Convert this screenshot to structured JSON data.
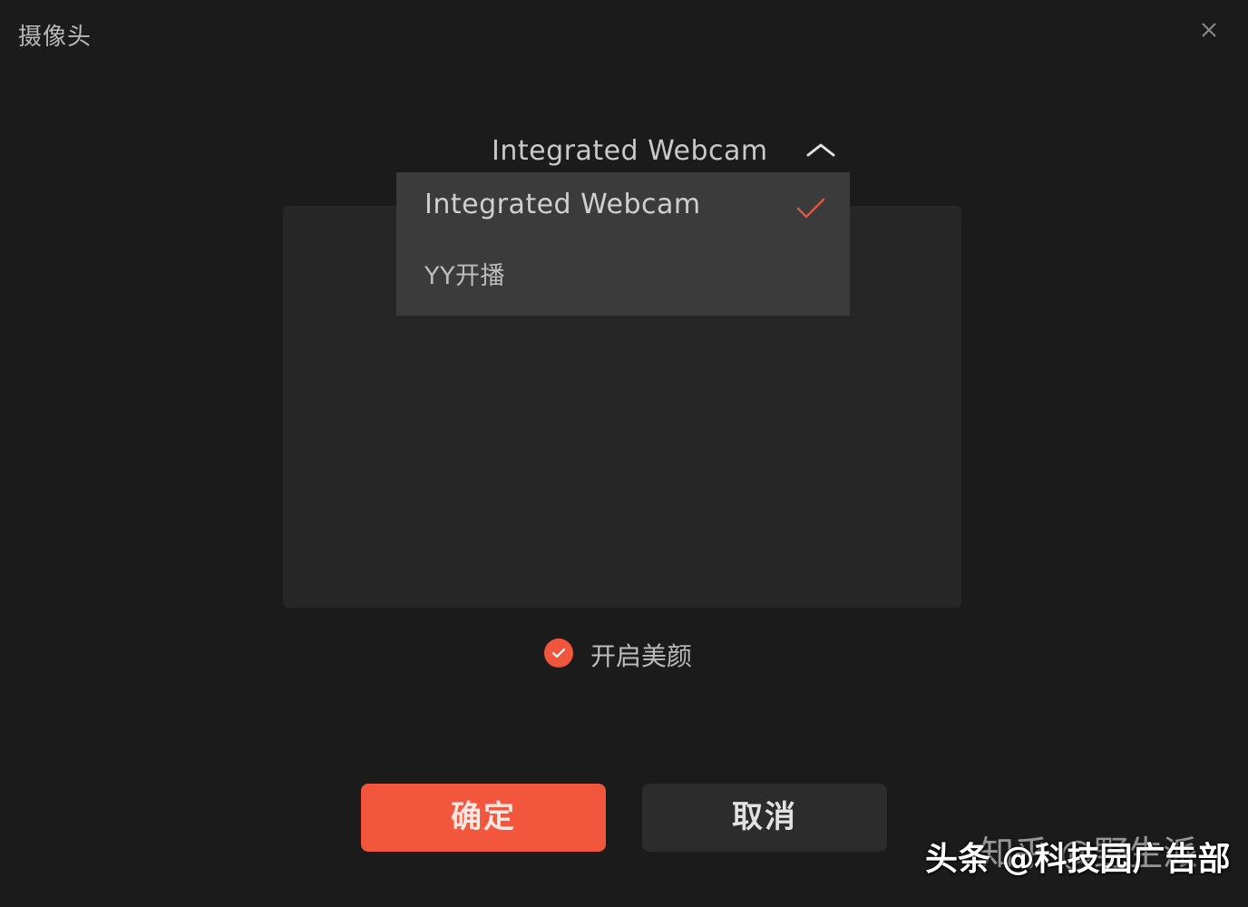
{
  "window": {
    "title": "摄像头",
    "close_icon": "close-icon"
  },
  "camera_select": {
    "selected_value": "Integrated Webcam",
    "expanded": true,
    "chevron_icon": "chevron-up-icon",
    "options": [
      {
        "label": "Integrated Webcam",
        "selected": true
      },
      {
        "label": "YY开播",
        "selected": false
      }
    ],
    "check_icon": "check-icon"
  },
  "beauty": {
    "label": "开启美颜",
    "checked": true
  },
  "buttons": {
    "ok_label": "确定",
    "cancel_label": "取消"
  },
  "colors": {
    "accent": "#f2573d",
    "background": "#1b1b1c",
    "preview_bg": "#262627",
    "dropdown_bg": "#3b3b3c"
  },
  "watermark": {
    "text": "头条 @科技园广告部",
    "overlay_text": "知乎 @野生派"
  }
}
